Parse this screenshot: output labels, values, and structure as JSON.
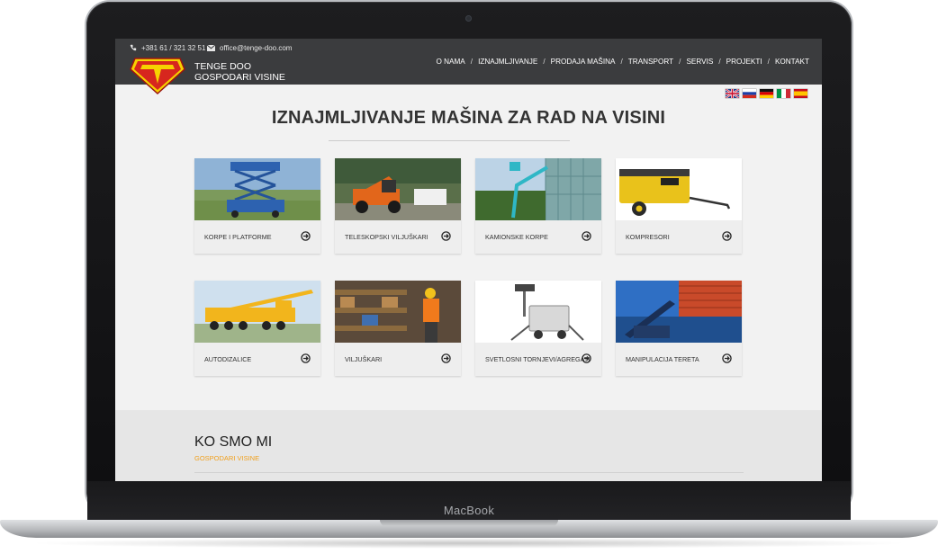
{
  "device": {
    "brand": "MacBook"
  },
  "header": {
    "phone": "+381 61 / 321 32 51",
    "email": "office@tenge-doo.com",
    "company_line1": "TENGE DOO",
    "company_line2": "GOSPODARI VISINE",
    "nav": [
      {
        "label": "O NAMA"
      },
      {
        "label": "IZNAJMLJIVANJE"
      },
      {
        "label": "PRODAJA MAŠINA"
      },
      {
        "label": "TRANSPORT"
      },
      {
        "label": "SERVIS"
      },
      {
        "label": "PROJEKTI"
      },
      {
        "label": "KONTAKT"
      }
    ],
    "nav_separator": "/"
  },
  "languages": [
    "english",
    "russian",
    "german",
    "italian",
    "spanish"
  ],
  "main": {
    "title": "IZNAJMLJIVANJE MAŠINA ZA RAD NA VISINI",
    "cards": [
      {
        "label": "KORPE I PLATFORME"
      },
      {
        "label": "TELESKOPSKI VILJUŠKARI"
      },
      {
        "label": "KAMIONSKE KORPE"
      },
      {
        "label": "KOMPRESORI"
      },
      {
        "label": "AUTODIZALICE"
      },
      {
        "label": "VILJUŠKARI"
      },
      {
        "label": "SVETLOSNI TORNJEVI/AGREGATI"
      },
      {
        "label": "MANIPULACIJA TERETA"
      }
    ]
  },
  "about": {
    "title": "KO SMO MI",
    "subtitle": "GOSPODARI VISINE"
  },
  "colors": {
    "header_bg": "#3b3c3e",
    "accent": "#f0a01e",
    "logo_red": "#d7261e",
    "logo_yellow": "#f6d200"
  },
  "icons": {
    "phone": "phone-icon",
    "email": "envelope-icon",
    "card_arrow": "circle-arrow-right-icon"
  }
}
